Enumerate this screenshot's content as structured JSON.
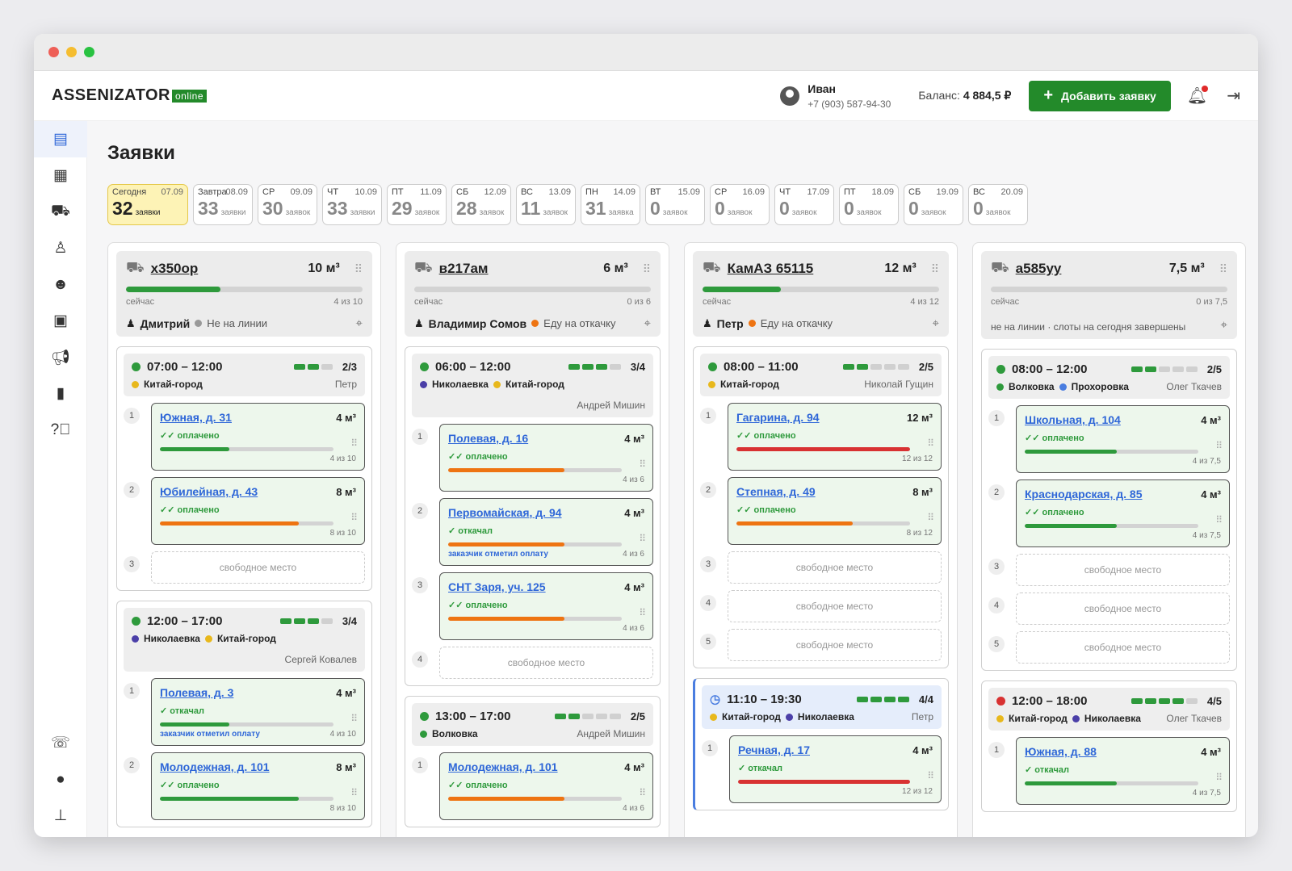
{
  "app": {
    "logo_main": "ASSENIZATOR",
    "logo_tag": "online"
  },
  "user": {
    "name": "Иван",
    "phone": "+7 (903) 587-94-30",
    "balance_label": "Баланс:",
    "balance_value": "4 884,5 ₽"
  },
  "add_button": "Добавить заявку",
  "page_title": "Заявки",
  "days": [
    {
      "name": "Сегодня",
      "date": "07.09",
      "count": "32",
      "label": "заявки",
      "today": true
    },
    {
      "name": "Завтра",
      "date": "08.09",
      "count": "33",
      "label": "заявки"
    },
    {
      "name": "СР",
      "date": "09.09",
      "count": "30",
      "label": "заявок"
    },
    {
      "name": "ЧТ",
      "date": "10.09",
      "count": "33",
      "label": "заявки"
    },
    {
      "name": "ПТ",
      "date": "11.09",
      "count": "29",
      "label": "заявок"
    },
    {
      "name": "СБ",
      "date": "12.09",
      "count": "28",
      "label": "заявок"
    },
    {
      "name": "ВС",
      "date": "13.09",
      "count": "11",
      "label": "заявок"
    },
    {
      "name": "ПН",
      "date": "14.09",
      "count": "31",
      "label": "заявка"
    },
    {
      "name": "ВТ",
      "date": "15.09",
      "count": "0",
      "label": "заявок"
    },
    {
      "name": "СР",
      "date": "16.09",
      "count": "0",
      "label": "заявок"
    },
    {
      "name": "ЧТ",
      "date": "17.09",
      "count": "0",
      "label": "заявок"
    },
    {
      "name": "ПТ",
      "date": "18.09",
      "count": "0",
      "label": "заявок"
    },
    {
      "name": "СБ",
      "date": "19.09",
      "count": "0",
      "label": "заявок"
    },
    {
      "name": "ВС",
      "date": "20.09",
      "count": "0",
      "label": "заявок"
    }
  ],
  "colors": {
    "green": "#2e9a3c",
    "orange": "#ee7412",
    "red": "#d83232",
    "blue": "#2f67d8",
    "yellow": "#e8b81c",
    "purple": "#4b3fa8"
  },
  "free_label": "свободное место",
  "now_label": "сейчас",
  "trucks": [
    {
      "plate": "х350ор",
      "volume": "10 м³",
      "fill": 0.4,
      "load": "4 из 10",
      "driver": "Дмитрий",
      "status": "Не на линии",
      "status_color": "#999999",
      "slots": [
        {
          "time": "07:00 – 12:00",
          "segs": 3,
          "on": 2,
          "cap": "2/3",
          "dot": "#2e9a3c",
          "areas": [
            {
              "n": "Китай-город",
              "c": "#e8b81c"
            }
          ],
          "oper": "Петр",
          "oper_inline": true,
          "orders": [
            {
              "n": "1",
              "addr": "Южная, д. 31",
              "vol": "4 м³",
              "status": "оплачено",
              "icon": "✓✓",
              "fill": 0.4,
              "color": "g",
              "load": "4 из 10"
            },
            {
              "n": "2",
              "addr": "Юбилейная, д. 43",
              "vol": "8 м³",
              "status": "оплачено",
              "icon": "✓✓",
              "fill": 0.8,
              "color": "o",
              "load": "8 из 10"
            },
            {
              "n": "3",
              "free": true
            }
          ]
        },
        {
          "time": "12:00 – 17:00",
          "segs": 4,
          "on": 3,
          "cap": "3/4",
          "dot": "#2e9a3c",
          "areas": [
            {
              "n": "Николаевка",
              "c": "#4b3fa8"
            },
            {
              "n": "Китай-город",
              "c": "#e8b81c"
            }
          ],
          "oper": "Сергей Ковалев",
          "oper_inline": false,
          "orders": [
            {
              "n": "1",
              "addr": "Полевая, д. 3",
              "vol": "4 м³",
              "status": "откачал",
              "icon": "✓",
              "fill": 0.4,
              "color": "g",
              "load": "4 из 10",
              "paid": "заказчик отметил оплату"
            },
            {
              "n": "2",
              "addr": "Молодежная, д. 101",
              "vol": "8 м³",
              "status": "оплачено",
              "icon": "✓✓",
              "fill": 0.8,
              "color": "g",
              "load": "8 из 10"
            }
          ]
        }
      ]
    },
    {
      "plate": "в217ам",
      "volume": "6 м³",
      "fill": 0,
      "load": "0 из 6",
      "driver": "Владимир Сомов",
      "status": "Еду на откачку",
      "status_color": "#ee7412",
      "slots": [
        {
          "time": "06:00 – 12:00",
          "segs": 4,
          "on": 3,
          "cap": "3/4",
          "dot": "#2e9a3c",
          "areas": [
            {
              "n": "Николаевка",
              "c": "#4b3fa8"
            },
            {
              "n": "Китай-город",
              "c": "#e8b81c"
            }
          ],
          "oper": "Андрей Мишин",
          "oper_inline": false,
          "orders": [
            {
              "n": "1",
              "addr": "Полевая, д. 16",
              "vol": "4 м³",
              "status": "оплачено",
              "icon": "✓✓",
              "fill": 0.67,
              "color": "o",
              "load": "4 из 6"
            },
            {
              "n": "2",
              "addr": "Первомайская, д. 94",
              "vol": "4 м³",
              "status": "откачал",
              "icon": "✓",
              "fill": 0.67,
              "color": "o",
              "load": "4 из 6",
              "paid": "заказчик отметил оплату"
            },
            {
              "n": "3",
              "addr": "СНТ Заря, уч. 125",
              "vol": "4 м³",
              "status": "оплачено",
              "icon": "✓✓",
              "fill": 0.67,
              "color": "o",
              "load": "4 из 6"
            },
            {
              "n": "4",
              "free": true
            }
          ]
        },
        {
          "time": "13:00 – 17:00",
          "segs": 5,
          "on": 2,
          "cap": "2/5",
          "dot": "#2e9a3c",
          "areas": [
            {
              "n": "Волковка",
              "c": "#2e9a3c"
            }
          ],
          "oper": "Андрей Мишин",
          "oper_inline": true,
          "orders": [
            {
              "n": "1",
              "addr": "Молодежная, д. 101",
              "vol": "4 м³",
              "status": "оплачено",
              "icon": "✓✓",
              "fill": 0.67,
              "color": "o",
              "load": "4 из 6"
            }
          ]
        }
      ]
    },
    {
      "plate": "КамАЗ 65115",
      "volume": "12 м³",
      "fill": 0.33,
      "load": "4 из 12",
      "driver": "Петр",
      "status": "Еду на откачку",
      "status_color": "#ee7412",
      "slots": [
        {
          "time": "08:00 – 11:00",
          "segs": 5,
          "on": 2,
          "cap": "2/5",
          "dot": "#2e9a3c",
          "areas": [
            {
              "n": "Китай-город",
              "c": "#e8b81c"
            }
          ],
          "oper": "Николай Гущин",
          "oper_inline": true,
          "orders": [
            {
              "n": "1",
              "addr": "Гагарина, д. 94",
              "vol": "12 м³",
              "status": "оплачено",
              "icon": "✓✓",
              "fill": 1,
              "color": "r",
              "load": "12 из 12"
            },
            {
              "n": "2",
              "addr": "Степная, д. 49",
              "vol": "8 м³",
              "status": "оплачено",
              "icon": "✓✓",
              "fill": 0.67,
              "color": "o",
              "load": "8 из 12"
            },
            {
              "n": "3",
              "free": true
            },
            {
              "n": "4",
              "free": true
            },
            {
              "n": "5",
              "free": true
            }
          ]
        },
        {
          "time": "11:10 – 19:30",
          "segs": 4,
          "on": 4,
          "cap": "4/4",
          "dot": "clock",
          "blue": true,
          "areas": [
            {
              "n": "Китай-город",
              "c": "#e8b81c"
            },
            {
              "n": "Николаевка",
              "c": "#4b3fa8"
            }
          ],
          "oper": "Петр",
          "oper_inline": true,
          "orders": [
            {
              "n": "1",
              "addr": "Речная, д. 17",
              "vol": "4 м³",
              "status": "откачал",
              "icon": "✓",
              "fill": 1,
              "color": "r",
              "load": "12 из 12"
            }
          ]
        }
      ]
    },
    {
      "plate": "а585уу",
      "volume": "7,5 м³",
      "fill": 0,
      "load": "0 из 7,5",
      "driver": "",
      "status": "не на линии · слоты на сегодня завершены",
      "status_color": "",
      "slots": [
        {
          "time": "08:00 – 12:00",
          "segs": 5,
          "on": 2,
          "cap": "2/5",
          "dot": "#2e9a3c",
          "areas": [
            {
              "n": "Волковка",
              "c": "#2e9a3c"
            },
            {
              "n": "Прохоровка",
              "c": "#4a7de0"
            }
          ],
          "oper": "Олег Ткачев",
          "oper_inline": true,
          "orders": [
            {
              "n": "1",
              "addr": "Школьная, д. 104",
              "vol": "4 м³",
              "status": "оплачено",
              "icon": "✓✓",
              "fill": 0.53,
              "color": "g",
              "load": "4 из 7,5"
            },
            {
              "n": "2",
              "addr": "Краснодарская, д. 85",
              "vol": "4 м³",
              "status": "оплачено",
              "icon": "✓✓",
              "fill": 0.53,
              "color": "g",
              "load": "4 из 7,5"
            },
            {
              "n": "3",
              "free": true
            },
            {
              "n": "4",
              "free": true
            },
            {
              "n": "5",
              "free": true
            }
          ]
        },
        {
          "time": "12:00 – 18:00",
          "segs": 5,
          "on": 4,
          "cap": "4/5",
          "dot": "#d83232",
          "areas": [
            {
              "n": "Китай-город",
              "c": "#e8b81c"
            },
            {
              "n": "Николаевка",
              "c": "#4b3fa8"
            }
          ],
          "oper": "Олег Ткачев",
          "oper_inline": true,
          "orders": [
            {
              "n": "1",
              "addr": "Южная, д. 88",
              "vol": "4 м³",
              "status": "откачал",
              "icon": "✓",
              "fill": 0.53,
              "color": "g",
              "load": "4 из 7,5"
            }
          ]
        }
      ]
    }
  ]
}
